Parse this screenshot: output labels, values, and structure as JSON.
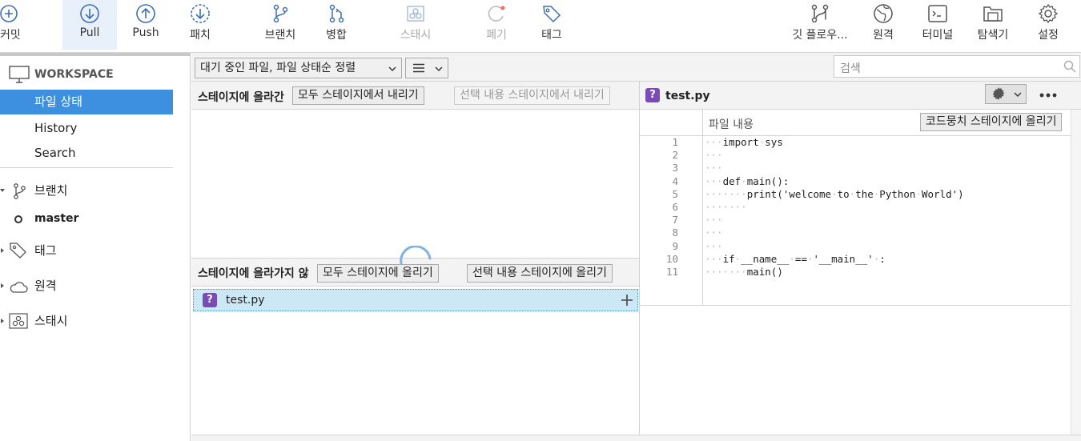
{
  "toolbar": {
    "commit": "커밋",
    "pull": "Pull",
    "push": "Push",
    "fetch": "패치",
    "branch": "브랜치",
    "merge": "병합",
    "stash": "스태시",
    "discard": "폐기",
    "tag": "태그",
    "gitflow": "깃 플로우...",
    "remote": "원격",
    "terminal": "터미널",
    "explorer": "탐색기",
    "settings": "설정"
  },
  "sidebar": {
    "workspace": "WORKSPACE",
    "file_status": "파일 상태",
    "history": "History",
    "search": "Search",
    "branches": "브랜치",
    "master": "master",
    "tags": "태그",
    "remotes": "원격",
    "stashes": "스태시"
  },
  "filter": {
    "sort_label": "대기 중인 파일, 파일 상태순 정렬",
    "view_icon": "list-icon",
    "search_placeholder": "검색"
  },
  "staged": {
    "header": "스테이지에 올라간",
    "unstage_all": "모두 스테이지에서 내리기",
    "unstage_selected": "선택 내용 스테이지에서 내리기"
  },
  "unstaged": {
    "header": "스테이지에 올라가지 않",
    "stage_all": "모두 스테이지에 올리기",
    "stage_selected": "선택 내용 스테이지에 올리기",
    "files": [
      {
        "name": "test.py",
        "status": "untracked"
      }
    ]
  },
  "diff": {
    "filename": "test.py",
    "section_label": "파일 내용",
    "stage_hunk": "코드뭉치 스테이지에 올리기",
    "lines": [
      {
        "n": "1",
        "text": "import sys"
      },
      {
        "n": "2",
        "text": ""
      },
      {
        "n": "3",
        "text": ""
      },
      {
        "n": "4",
        "text": "def main():"
      },
      {
        "n": "5",
        "text": "    print('welcome to the Python World')"
      },
      {
        "n": "6",
        "text": "    "
      },
      {
        "n": "7",
        "text": ""
      },
      {
        "n": "8",
        "text": ""
      },
      {
        "n": "9",
        "text": ""
      },
      {
        "n": "10",
        "text": "if __name__ == '__main__' :"
      },
      {
        "n": "11",
        "text": "    main()"
      }
    ]
  },
  "colors": {
    "accent": "#3d8fe0",
    "selection_bg": "#cde8f5",
    "untracked_badge": "#7a4bb5"
  }
}
